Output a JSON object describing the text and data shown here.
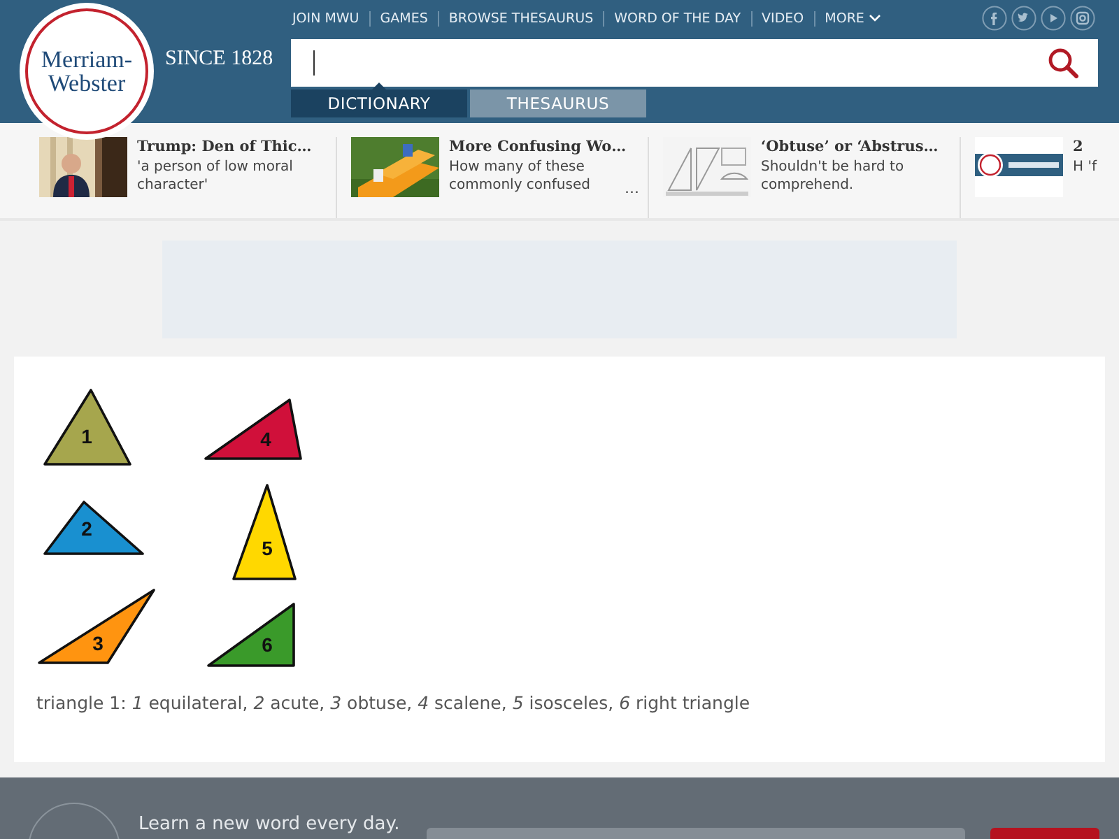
{
  "logo": {
    "line1": "Merriam-",
    "line2": "Webster",
    "since": "SINCE 1828"
  },
  "nav": [
    "JOIN MWU",
    "GAMES",
    "BROWSE THESAURUS",
    "WORD OF THE DAY",
    "VIDEO",
    "MORE"
  ],
  "social": [
    {
      "kind": "facebook"
    },
    {
      "kind": "twitter"
    },
    {
      "kind": "play"
    },
    {
      "kind": "camera"
    }
  ],
  "search_tabs": [
    {
      "label": "DICTIONARY",
      "selected": true
    },
    {
      "label": "THESAURUS",
      "selected": false
    }
  ],
  "stories": [
    {
      "title": "Trump: Den of Thic…",
      "text": "'a person of low moral character'"
    },
    {
      "title": "More Confusing Wo…",
      "text": "How many of these commonly confused",
      "more": "…"
    },
    {
      "title": "‘Obtuse’ or ‘Abstrus…",
      "text": "Shouldn't be hard to comprehend."
    },
    {
      "title": "2",
      "text": "H 'f"
    }
  ],
  "figure": {
    "triangles": [
      {
        "number": "1",
        "color": "#a6a64d",
        "kind": "equilateral"
      },
      {
        "number": "4",
        "color": "#d0103a",
        "kind": "scalene"
      },
      {
        "number": "2",
        "color": "#1990d0",
        "kind": "acute"
      },
      {
        "number": "5",
        "color": "#ffd800",
        "kind": "isosceles"
      },
      {
        "number": "3",
        "color": "#ff9410",
        "kind": "obtuse"
      },
      {
        "number": "6",
        "color": "#3a9a2a",
        "kind": "right"
      }
    ],
    "caption": "triangle 1: *1* equilateral, *2* acute, *3* obtuse, *4* scalene, *5* isosceles, *6* right triangle"
  },
  "footer": {
    "text": "Learn a new word every day."
  }
}
